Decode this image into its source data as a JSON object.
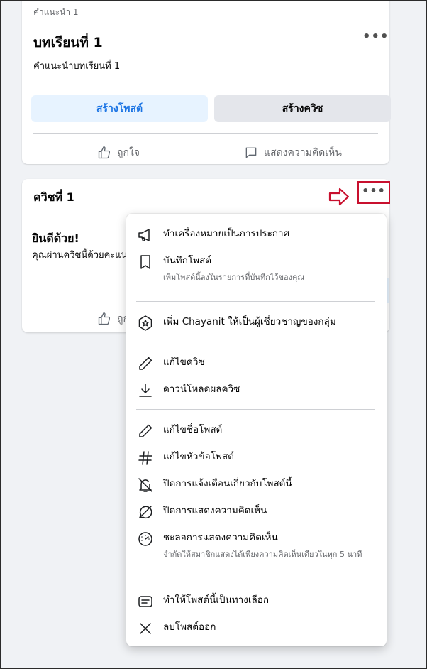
{
  "lesson_card": {
    "eyebrow": "คำแนะนำ 1",
    "title": "บทเรียนที่ 1",
    "description": "คำแนะนำบทเรียนที่ 1",
    "more_label": "•••",
    "create_post_label": "สร้างโพสต์",
    "create_quiz_label": "สร้างควิซ",
    "like_label": "ถูกใจ",
    "comment_label": "แสดงความคิดเห็น"
  },
  "quiz_card": {
    "title": "ควิซที่ 1",
    "more_label": "•••",
    "congrats": "ยินดีด้วย!",
    "subtitle": "คุณผ่านควิซนี้ด้วยคะแนน",
    "like_label": "ถูกใจ"
  },
  "menu": {
    "items": [
      {
        "label": "ทำเครื่องหมายเป็นการประกาศ",
        "icon": "megaphone-icon"
      },
      {
        "label": "บันทึกโพสต์",
        "sub": "เพิ่มโพสต์นี้ลงในรายการที่บันทึกไว้ของคุณ",
        "icon": "bookmark-icon"
      },
      {
        "label": "เพิ่ม Chayanit ให้เป็นผู้เชี่ยวชาญของกลุ่ม",
        "icon": "expert-badge-icon"
      },
      {
        "label": "แก้ไขควิซ",
        "icon": "pencil-icon"
      },
      {
        "label": "ดาวน์โหลดผลควิซ",
        "icon": "download-icon"
      },
      {
        "label": "แก้ไขชื่อโพสต์",
        "icon": "pencil-icon"
      },
      {
        "label": "แก้ไขหัวข้อโพสต์",
        "icon": "hashtag-icon"
      },
      {
        "label": "ปิดการแจ้งเตือนเกี่ยวกับโพสต์นี้",
        "icon": "bell-off-icon"
      },
      {
        "label": "ปิดการแสดงความคิดเห็น",
        "icon": "comment-off-icon"
      },
      {
        "label": "ชะลอการแสดงความคิดเห็น",
        "sub": "จำกัดให้สมาชิกแสดงได้เพียงความคิดเห็นเดียวในทุก 5 นาที",
        "icon": "gauge-icon"
      },
      {
        "label": "ทำให้โพสต์นี้เป็นทางเลือก",
        "icon": "note-icon"
      },
      {
        "label": "ลบโพสต์ออก",
        "icon": "close-icon"
      }
    ]
  },
  "colors": {
    "accent_blue": "#1b74e4",
    "highlight_red": "#c8102e",
    "background": "#f0f2f5"
  }
}
